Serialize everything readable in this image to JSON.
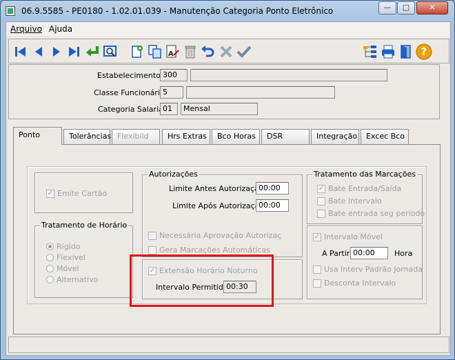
{
  "window": {
    "title": "06.9.5585 - PE0180 - 1.02.01.039 - Manutenção Categoria Ponto Eletrônico",
    "minimize_glyph": "—",
    "maximize_glyph": "□",
    "close_glyph": "✕"
  },
  "menu": {
    "items": [
      {
        "label": "Arquivo"
      },
      {
        "label": "Ajuda"
      }
    ]
  },
  "toolbar": {
    "buttons": [
      "first-record-icon",
      "previous-record-icon",
      "next-record-icon",
      "last-record-icon",
      "goto-icon",
      "zoom-icon",
      "new-icon",
      "copy-icon",
      "edit-icon",
      "delete-icon",
      "undo-icon",
      "cancel-icon",
      "confirm-icon",
      "navigate-tree-icon",
      "print-icon",
      "exit-icon",
      "help-icon"
    ],
    "help_glyph": "?"
  },
  "header": {
    "estabelecimento": {
      "label": "Estabelecimento:",
      "code": "300",
      "desc": ""
    },
    "classe": {
      "label": "Classe Funcionário:",
      "code": "5",
      "desc": ""
    },
    "categoria": {
      "label": "Categoria Salarial:",
      "code": "01",
      "desc": "Mensal"
    }
  },
  "tabs": [
    {
      "label": "Ponto",
      "selected": true,
      "enabled": true
    },
    {
      "label": "Tolerâncias",
      "selected": false,
      "enabled": true
    },
    {
      "label": "Flexibild",
      "selected": false,
      "enabled": false
    },
    {
      "label": "Hrs Extras",
      "selected": false,
      "enabled": true
    },
    {
      "label": "Bco Horas",
      "selected": false,
      "enabled": true
    },
    {
      "label": "DSR",
      "selected": false,
      "enabled": true
    },
    {
      "label": "Integração",
      "selected": false,
      "enabled": true
    },
    {
      "label": "Excec Bco",
      "selected": false,
      "enabled": true
    }
  ],
  "ponto": {
    "emite_cartao": {
      "label": "Emite Cartão",
      "checked": true
    },
    "tratamento_horario": {
      "title": "Tratamento de Horário",
      "options": [
        {
          "label": "Rígido",
          "selected": true
        },
        {
          "label": "Flexível",
          "selected": false
        },
        {
          "label": "Móvel",
          "selected": false
        },
        {
          "label": "Alternativo",
          "selected": false
        }
      ]
    },
    "autorizacoes": {
      "title": "Autorizações",
      "limite_antes": {
        "label": "Limite Antes Autorização:",
        "value": "00:00"
      },
      "limite_apos": {
        "label": "Limite Após Autorização:",
        "value": "00:00"
      },
      "necessaria_aprovacao": {
        "label": "Necessária Aprovação Autorizaç",
        "checked": false
      },
      "gera_marcacoes": {
        "label": "Gera Marcações Automáticas",
        "checked": false
      }
    },
    "extensao": {
      "label": "Extensão Horário Noturno",
      "checked": true,
      "intervalo_label": "Intervalo Permitido:",
      "intervalo_value": "00:30"
    },
    "tratamento_marcacoes": {
      "title": "Tratamento das Marcações",
      "options": [
        {
          "label": "Bate Entrada/Saída",
          "checked": true
        },
        {
          "label": "Bate Intervalo",
          "checked": false
        },
        {
          "label": "Bate entrada seg período",
          "checked": false
        }
      ]
    },
    "intervalo_movel": {
      "label": "Intervalo Móvel",
      "checked": true,
      "a_partir_label": "A Partir:",
      "a_partir_value": "00:00",
      "hora_label": "Hora",
      "usa_interv": {
        "label": "Usa Interv Padrão Jornada",
        "checked": false
      },
      "desconta": {
        "label": "Desconta Intervalo",
        "checked": false
      }
    }
  },
  "check_glyph": "✓",
  "colors": {
    "highlight": "#e0141b",
    "toolbar_blue": "#1e5fc8",
    "help_orange": "#f0a000"
  }
}
